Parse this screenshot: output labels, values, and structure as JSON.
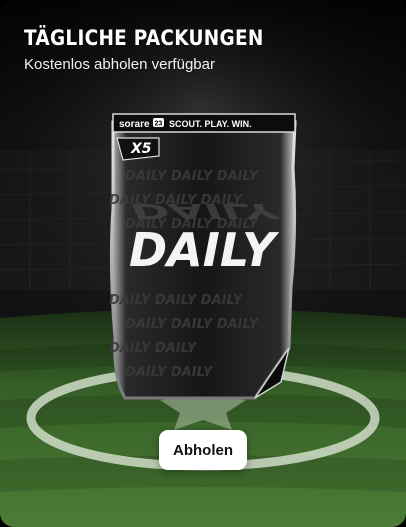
{
  "header": {
    "title": "TÄGLICHE PACKUNGEN",
    "subtitle": "Kostenlos abholen verfügbar"
  },
  "pack": {
    "brand": "sorare",
    "brand_badge": "23",
    "slogan": "SCOUT. PLAY. WIN.",
    "quantity": "X5",
    "name": "DAILY"
  },
  "actions": {
    "claim_label": "Abholen"
  },
  "colors": {
    "grass": "#3d6a2c",
    "grass_dark": "#1f3d17",
    "button_bg": "#ffffff",
    "title": "#ffffff"
  }
}
